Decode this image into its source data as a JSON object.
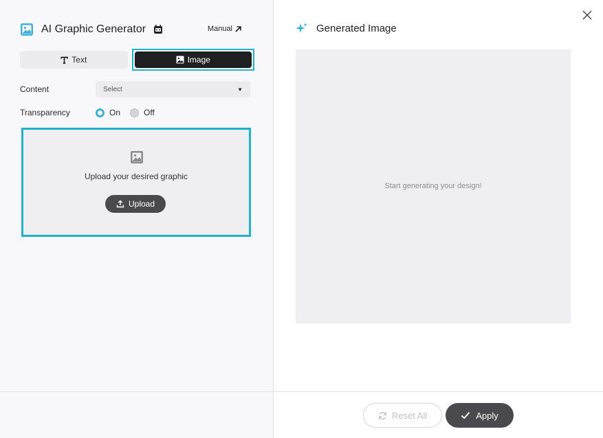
{
  "left_panel": {
    "title": "AI Graphic Generator",
    "manual_link": "Manual",
    "tabs": [
      {
        "label": "Text",
        "active": false
      },
      {
        "label": "Image",
        "active": true
      }
    ],
    "content": {
      "label": "Content",
      "selected": "Select"
    },
    "transparency": {
      "label": "Transparency",
      "options": [
        {
          "label": "On",
          "checked": true
        },
        {
          "label": "Off",
          "checked": false
        }
      ]
    },
    "upload": {
      "prompt": "Upload your desired graphic",
      "button_label": "Upload"
    }
  },
  "right_panel": {
    "title": "Generated Image",
    "placeholder": "Start generating your design!",
    "reset_label": "Reset All",
    "apply_label": "Apply"
  },
  "colors": {
    "accent": "#1fb2cb",
    "radio_on": "#3fb1d6",
    "dark_button": "#4a4a4e",
    "active_tab": "#1f1f21"
  }
}
